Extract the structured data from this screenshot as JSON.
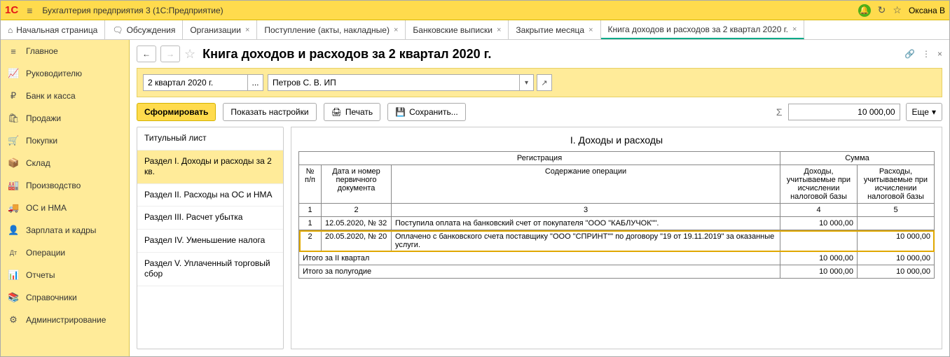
{
  "titlebar": {
    "app_title": "Бухгалтерия предприятия 3   (1С:Предприятие)",
    "user": "Оксана В"
  },
  "tabs": [
    {
      "label": "Начальная страница",
      "icon": "⌂",
      "closable": false
    },
    {
      "label": "Обсуждения",
      "icon": "💬",
      "closable": false
    },
    {
      "label": "Организации",
      "closable": true
    },
    {
      "label": "Поступление (акты, накладные)",
      "closable": true
    },
    {
      "label": "Банковские выписки",
      "closable": true
    },
    {
      "label": "Закрытие месяца",
      "closable": true
    },
    {
      "label": "Книга доходов и расходов за 2 квартал 2020 г.",
      "closable": true,
      "active": true
    }
  ],
  "sidebar": [
    {
      "icon": "≡",
      "label": "Главное"
    },
    {
      "icon": "📈",
      "label": "Руководителю"
    },
    {
      "icon": "₽",
      "label": "Банк и касса"
    },
    {
      "icon": "🛍",
      "label": "Продажи"
    },
    {
      "icon": "🛒",
      "label": "Покупки"
    },
    {
      "icon": "📦",
      "label": "Склад"
    },
    {
      "icon": "🏭",
      "label": "Производство"
    },
    {
      "icon": "🚚",
      "label": "ОС и НМА"
    },
    {
      "icon": "👤",
      "label": "Зарплата и кадры"
    },
    {
      "icon": "Дт",
      "label": "Операции"
    },
    {
      "icon": "📊",
      "label": "Отчеты"
    },
    {
      "icon": "📚",
      "label": "Справочники"
    },
    {
      "icon": "⚙",
      "label": "Администрирование"
    }
  ],
  "page": {
    "title": "Книга доходов и расходов за 2 квартал 2020 г."
  },
  "filters": {
    "period": "2 квартал 2020 г.",
    "org": "Петров С. В. ИП"
  },
  "toolbar": {
    "form": "Сформировать",
    "settings": "Показать настройки",
    "print": "Печать",
    "save": "Сохранить...",
    "sum_value": "10 000,00",
    "more": "Еще"
  },
  "sections": [
    "Титульный лист",
    "Раздел I. Доходы и расходы за 2 кв.",
    "Раздел II. Расходы на ОС и НМА",
    "Раздел III. Расчет убытка",
    "Раздел IV. Уменьшение налога",
    "Раздел V. Уплаченный торговый сбор"
  ],
  "report": {
    "title": "I. Доходы и расходы",
    "headers": {
      "reg": "Регистрация",
      "sum": "Сумма",
      "num": "№ п/п",
      "date_no": "Дата и номер первичного документа",
      "content": "Содержание операции",
      "income": "Доходы, учитываемые при исчислении налоговой базы",
      "expense": "Расходы, учитываемые при исчислении налоговой базы"
    },
    "col_numbers": [
      "1",
      "2",
      "3",
      "4",
      "5"
    ],
    "rows": [
      {
        "n": "1",
        "date": "12.05.2020, № 32",
        "content": "Поступила оплата на банковский счет от покупателя \"ООО \"КАБЛУЧОК\"\".",
        "income": "10 000,00",
        "expense": ""
      },
      {
        "n": "2",
        "date": "20.05.2020, № 20",
        "content": "Оплачено с банковского счета поставщику \"ООО \"СПРИНТ\"\" по договору \"19 от 19.11.2019\" за оказанные услуги.",
        "income": "",
        "expense": "10 000,00"
      }
    ],
    "totals": [
      {
        "label": "Итого за II квартал",
        "income": "10 000,00",
        "expense": "10 000,00"
      },
      {
        "label": "Итого за полугодие",
        "income": "10 000,00",
        "expense": "10 000,00"
      }
    ]
  }
}
